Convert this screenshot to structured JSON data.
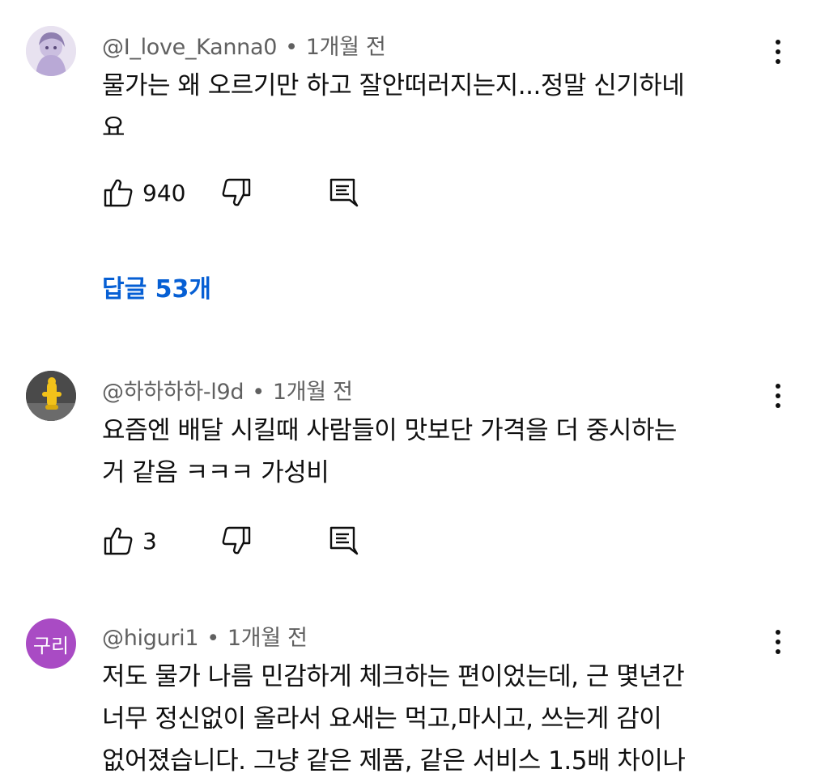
{
  "comments": [
    {
      "author": "@I_love_Kanna0",
      "dot": "•",
      "time": "1개월 전",
      "text_lines": [
        "물가는 왜 오르기만 하고 잘안떠러지는지...정말 신기하네",
        "요"
      ],
      "likes": "940",
      "replies_label": "답글 53개",
      "avatar_icon": "anime-avatar"
    },
    {
      "author": "@하하하하-l9d",
      "dot": "•",
      "time": "1개월 전",
      "text_lines": [
        "요즘엔 배달 시킬때 사람들이 맛보단 가격을 더 중시하는",
        "거 같음 ㅋㅋㅋ 가성비"
      ],
      "likes": "3",
      "avatar_icon": "yellow-figure-avatar"
    },
    {
      "author": "@higuri1",
      "dot": "•",
      "time": "1개월 전",
      "text_lines": [
        "저도 물가 나름 민감하게 체크하는 편이었는데,  근 몇년간",
        "너무 정신없이  올라서 요새는  먹고,마시고, 쓰는게 감이",
        "없어졌습니다.  그냥 같은 제품, 같은 서비스 1.5배 차이나"
      ],
      "avatar_text": "구리",
      "avatar_color": "#a94bc4"
    }
  ],
  "colors": {
    "link": "#065fd4",
    "meta": "#606060",
    "text": "#0f0f0f"
  }
}
